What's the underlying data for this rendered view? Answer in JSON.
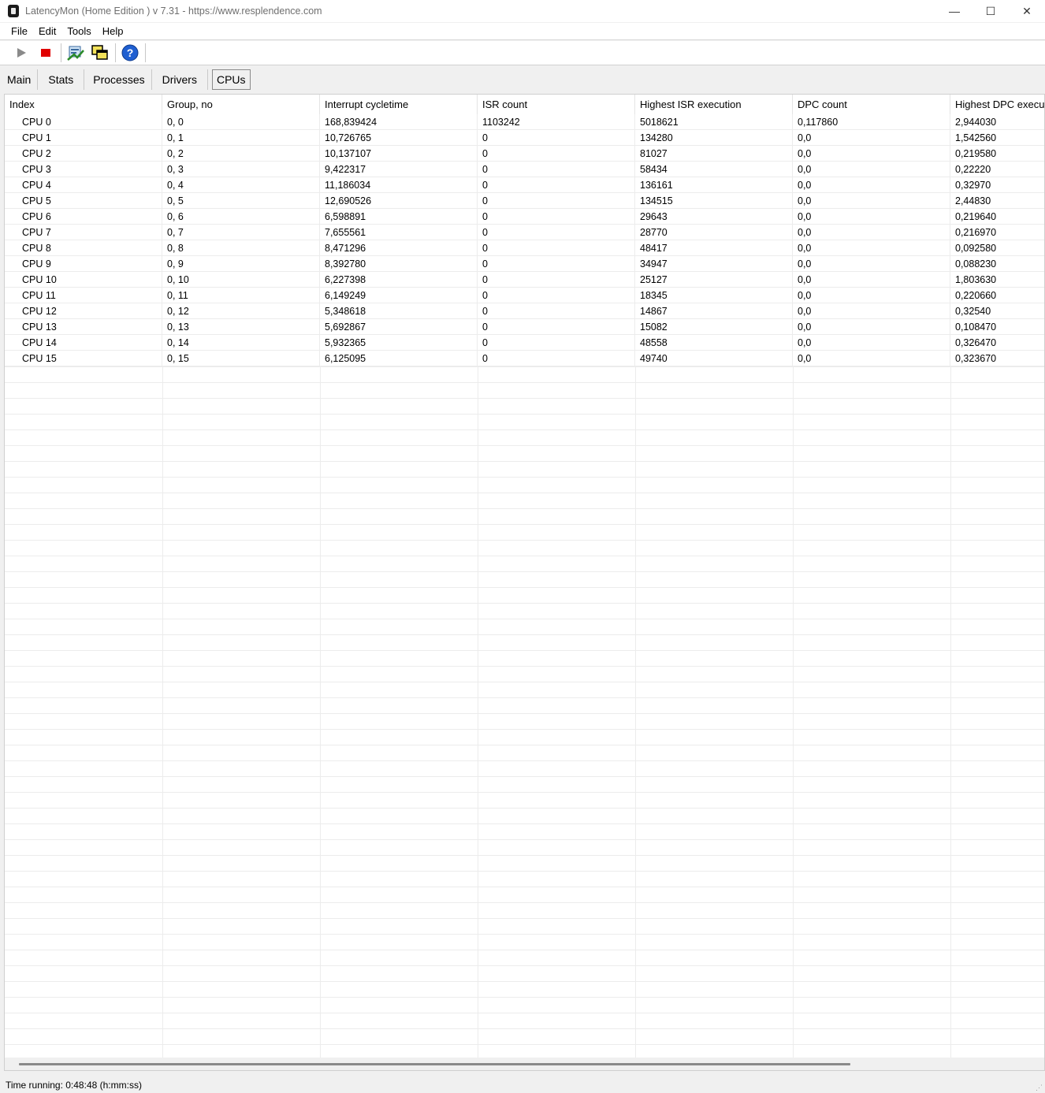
{
  "window": {
    "title": "LatencyMon  (Home Edition )  v 7.31 - https://www.resplendence.com",
    "controls": {
      "minimize": "—",
      "maximize": "☐",
      "close": "✕"
    }
  },
  "menu": {
    "items": [
      "File",
      "Edit",
      "Tools",
      "Help"
    ]
  },
  "toolbar": {
    "buttons": [
      {
        "name": "start-icon"
      },
      {
        "name": "stop-icon"
      },
      {
        "name": "report-icon"
      },
      {
        "name": "windows-icon"
      },
      {
        "name": "help-icon"
      }
    ]
  },
  "tabs": {
    "items": [
      "Main",
      "Stats",
      "Processes",
      "Drivers",
      "CPUs"
    ],
    "active": "CPUs"
  },
  "table": {
    "columns": [
      "Index",
      "Group, no",
      "Interrupt cycletime",
      "ISR count",
      "Highest ISR execution",
      "DPC count",
      "Highest DPC execu"
    ],
    "rows": [
      [
        "CPU 0",
        "0, 0",
        "168,839424",
        "1103242",
        "5018621",
        "0,117860",
        "2,944030"
      ],
      [
        "CPU 1",
        "0, 1",
        "10,726765",
        "0",
        "134280",
        "0,0",
        "1,542560"
      ],
      [
        "CPU 2",
        "0, 2",
        "10,137107",
        "0",
        "81027",
        "0,0",
        "0,219580"
      ],
      [
        "CPU 3",
        "0, 3",
        "9,422317",
        "0",
        "58434",
        "0,0",
        "0,22220"
      ],
      [
        "CPU 4",
        "0, 4",
        "11,186034",
        "0",
        "136161",
        "0,0",
        "0,32970"
      ],
      [
        "CPU 5",
        "0, 5",
        "12,690526",
        "0",
        "134515",
        "0,0",
        "2,44830"
      ],
      [
        "CPU 6",
        "0, 6",
        "6,598891",
        "0",
        "29643",
        "0,0",
        "0,219640"
      ],
      [
        "CPU 7",
        "0, 7",
        "7,655561",
        "0",
        "28770",
        "0,0",
        "0,216970"
      ],
      [
        "CPU 8",
        "0, 8",
        "8,471296",
        "0",
        "48417",
        "0,0",
        "0,092580"
      ],
      [
        "CPU 9",
        "0, 9",
        "8,392780",
        "0",
        "34947",
        "0,0",
        "0,088230"
      ],
      [
        "CPU 10",
        "0, 10",
        "6,227398",
        "0",
        "25127",
        "0,0",
        "1,803630"
      ],
      [
        "CPU 11",
        "0, 11",
        "6,149249",
        "0",
        "18345",
        "0,0",
        "0,220660"
      ],
      [
        "CPU 12",
        "0, 12",
        "5,348618",
        "0",
        "14867",
        "0,0",
        "0,32540"
      ],
      [
        "CPU 13",
        "0, 13",
        "5,692867",
        "0",
        "15082",
        "0,0",
        "0,108470"
      ],
      [
        "CPU 14",
        "0, 14",
        "5,932365",
        "0",
        "48558",
        "0,0",
        "0,326470"
      ],
      [
        "CPU 15",
        "0, 15",
        "6,125095",
        "0",
        "49740",
        "0,0",
        "0,323670"
      ]
    ]
  },
  "status": {
    "text": "Time running: 0:48:48  (h:mm:ss)"
  },
  "colors": {
    "stop": "#e00000",
    "play": "#8a8a8a",
    "help": "#1f5fd1"
  }
}
